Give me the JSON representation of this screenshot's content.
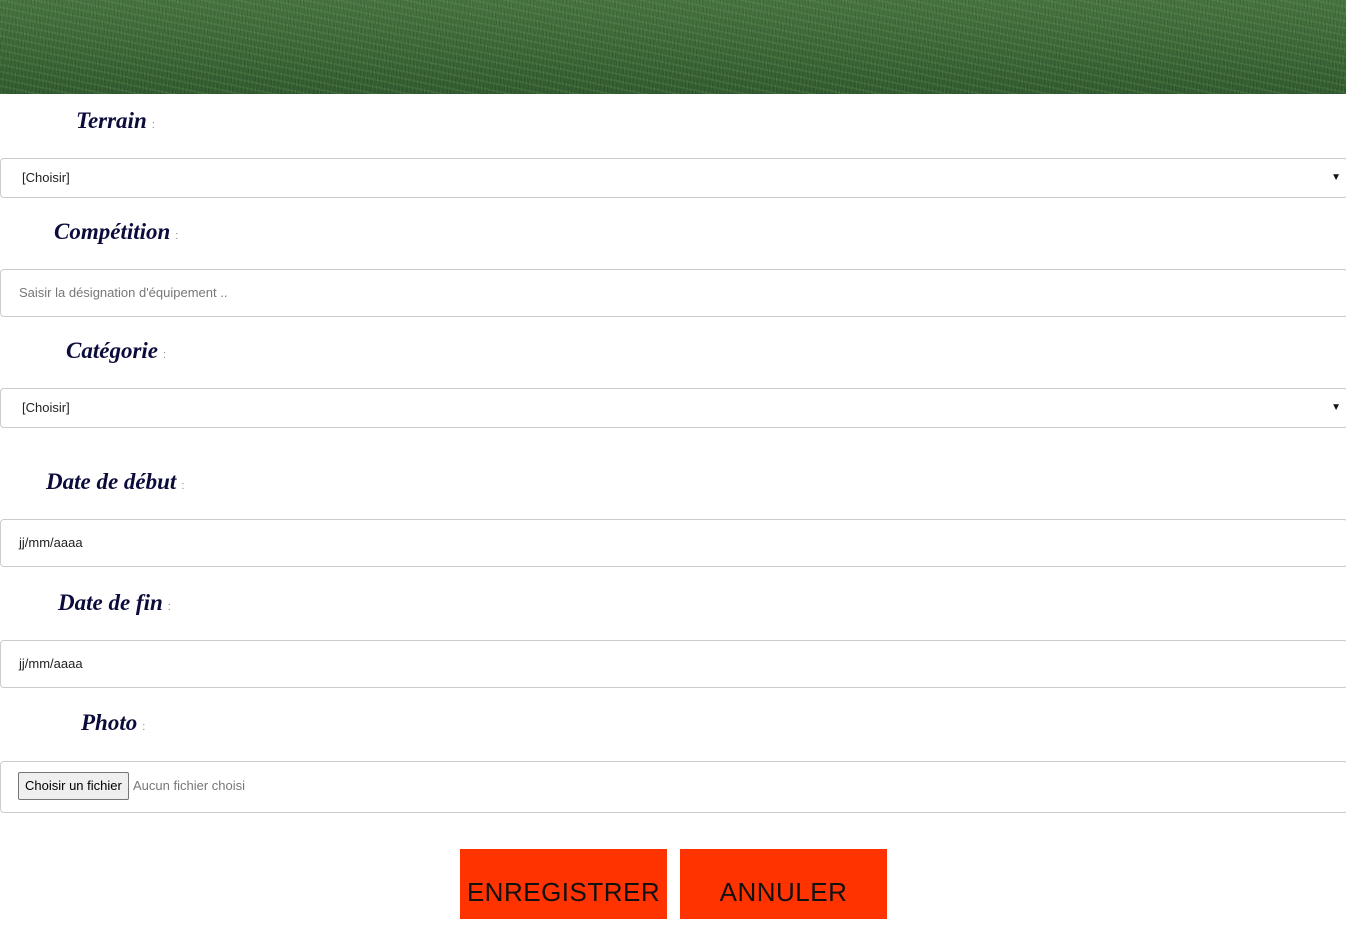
{
  "form": {
    "terrain": {
      "label": "Terrain",
      "colon": ":",
      "value": "[Choisir]"
    },
    "competition": {
      "label": "Compétition",
      "colon": ":",
      "placeholder": "Saisir la désignation d'équipement .."
    },
    "categorie": {
      "label": "Catégorie",
      "colon": ":",
      "value": "[Choisir]"
    },
    "date_debut": {
      "label": "Date de début",
      "colon": ":",
      "placeholder": "jj/mm/aaaa"
    },
    "date_fin": {
      "label": "Date de fin",
      "colon": ":",
      "placeholder": "jj/mm/aaaa"
    },
    "photo": {
      "label": "Photo",
      "colon": ":",
      "button_label": "Choisir un fichier",
      "status": "Aucun fichier choisi"
    }
  },
  "actions": {
    "save_label": "ENREGISTRER",
    "cancel_label": "ANNULER"
  },
  "colors": {
    "label_text": "#0c0c3c",
    "action_button_bg": "#ff3300",
    "banner_grass": "#3d6a38"
  },
  "icons": {
    "select_arrow": "chevron-down-icon"
  }
}
